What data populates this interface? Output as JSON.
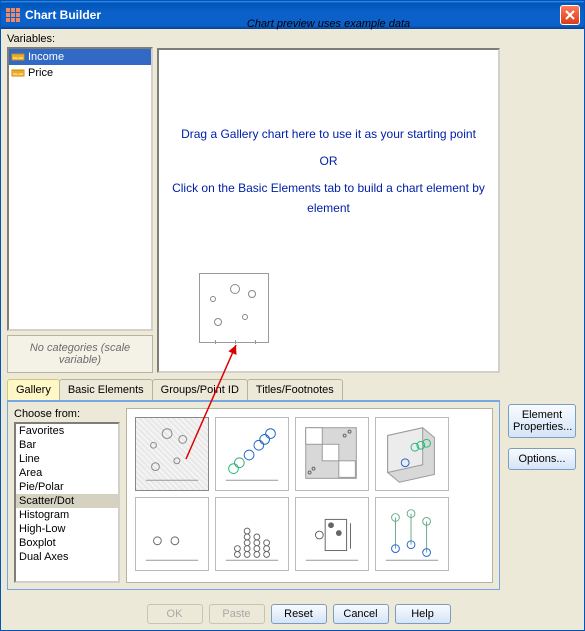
{
  "window": {
    "title": "Chart Builder"
  },
  "labels": {
    "variables": "Variables:",
    "preview_header": "Chart preview uses example data",
    "no_categories": "No categories (scale variable)",
    "choose_from": "Choose from:"
  },
  "variables": [
    {
      "name": "Income",
      "selected": true
    },
    {
      "name": "Price",
      "selected": false
    }
  ],
  "preview_instructions": {
    "line1": "Drag a Gallery chart here to use it as your starting point",
    "or": "OR",
    "line2": "Click on the Basic Elements tab to build a chart element by element"
  },
  "tabs": [
    {
      "label": "Gallery",
      "active": true
    },
    {
      "label": "Basic Elements",
      "active": false
    },
    {
      "label": "Groups/Point ID",
      "active": false
    },
    {
      "label": "Titles/Footnotes",
      "active": false
    }
  ],
  "choose_from": [
    "Favorites",
    "Bar",
    "Line",
    "Area",
    "Pie/Polar",
    "Scatter/Dot",
    "Histogram",
    "High-Low",
    "Boxplot",
    "Dual Axes"
  ],
  "choose_selected": "Scatter/Dot",
  "side_buttons": {
    "element_props": "Element Properties...",
    "options": "Options..."
  },
  "bottom_buttons": {
    "ok": "OK",
    "paste": "Paste",
    "reset": "Reset",
    "cancel": "Cancel",
    "help": "Help"
  }
}
